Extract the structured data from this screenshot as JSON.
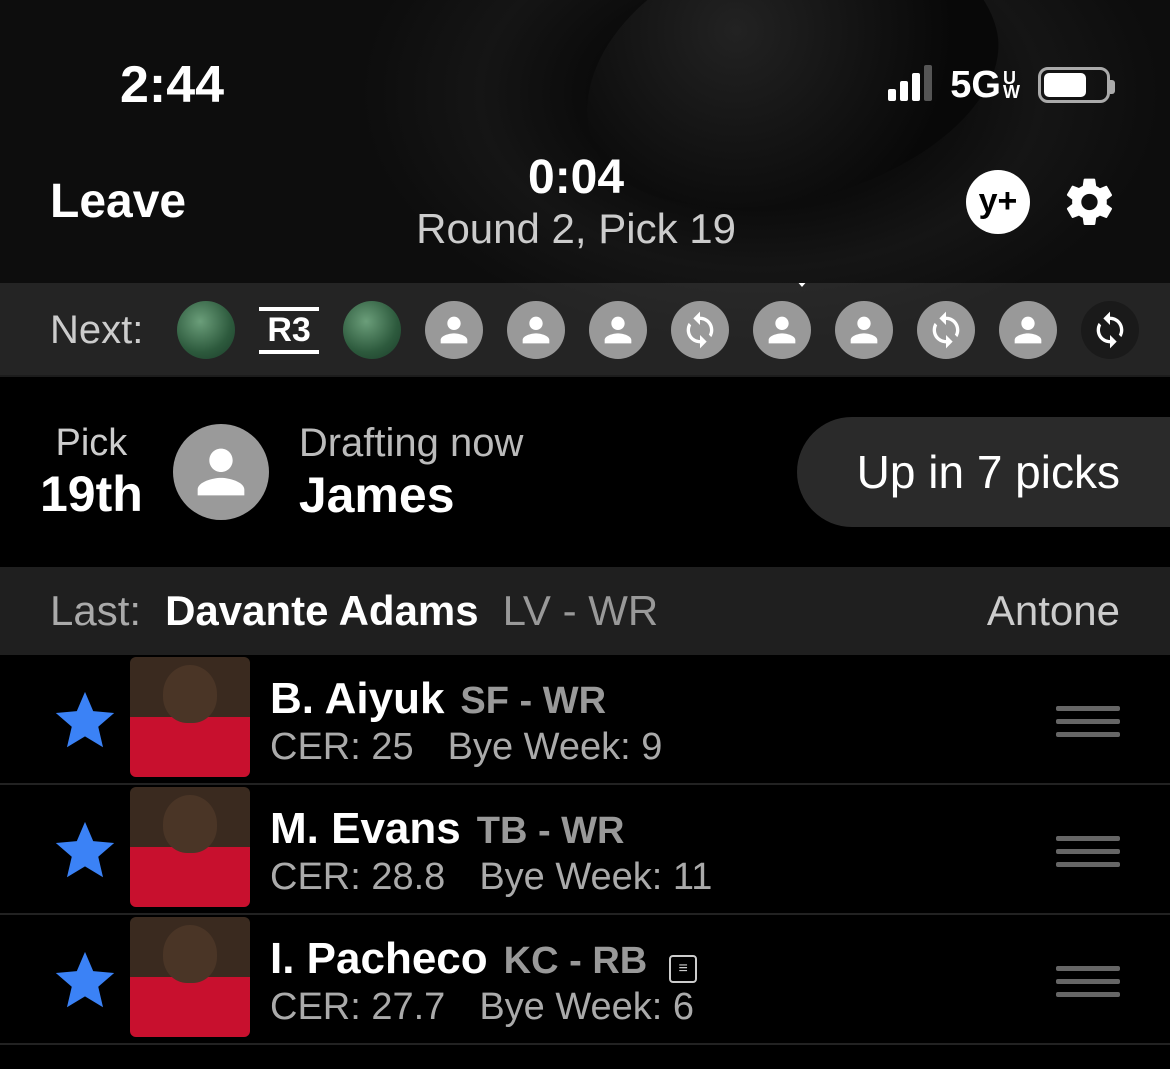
{
  "status": {
    "time": "2:44",
    "network": "5G",
    "network_sub_top": "U",
    "network_sub_bot": "W"
  },
  "header": {
    "leave": "Leave",
    "timer": "0:04",
    "round_pick": "Round 2, Pick 19",
    "yplus": "y+"
  },
  "next": {
    "label": "Next:",
    "round_divider": "R3"
  },
  "pick": {
    "label": "Pick",
    "value": "19th",
    "drafting_label": "Drafting now",
    "drafting_name": "James",
    "up_in": "Up in 7 picks"
  },
  "last": {
    "label": "Last:",
    "player": "Davante Adams",
    "teampos": "LV - WR",
    "owner": "Antone"
  },
  "players": [
    {
      "name": "B. Aiyuk",
      "teampos": "SF - WR",
      "cer": "CER: 25",
      "bye": "Bye Week: 9",
      "note": false
    },
    {
      "name": "M. Evans",
      "teampos": "TB - WR",
      "cer": "CER: 28.8",
      "bye": "Bye Week: 11",
      "note": false
    },
    {
      "name": "I. Pacheco",
      "teampos": "KC - RB",
      "cer": "CER: 27.7",
      "bye": "Bye Week: 6",
      "note": true
    }
  ]
}
